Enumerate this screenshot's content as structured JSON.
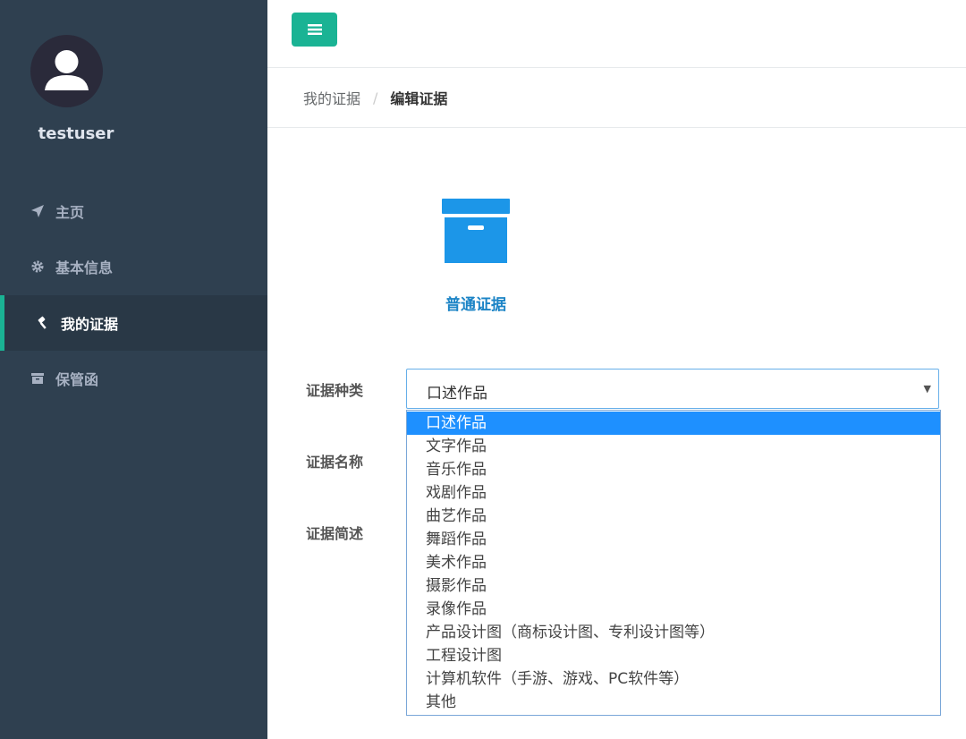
{
  "user": {
    "name": "testuser"
  },
  "nav": [
    {
      "label": "主页",
      "icon": "paper-plane-icon"
    },
    {
      "label": "基本信息",
      "icon": "gear-icon"
    },
    {
      "label": "我的证据",
      "icon": "gavel-icon",
      "active": true
    },
    {
      "label": "保管函",
      "icon": "archive-icon"
    }
  ],
  "toolbar": {
    "menu_icon": "hamburger-icon"
  },
  "breadcrumb": {
    "parent": "我的证据",
    "separator": "/",
    "current": "编辑证据"
  },
  "evidence_card": {
    "icon": "archive-box-icon",
    "label": "普通证据"
  },
  "form": {
    "type_label": "证据种类",
    "name_label": "证据名称",
    "desc_label": "证据简述",
    "type_value": "口述作品",
    "type_options": [
      "口述作品",
      "文字作品",
      "音乐作品",
      "戏剧作品",
      "曲艺作品",
      "舞蹈作品",
      "美术作品",
      "摄影作品",
      "录像作品",
      "产品设计图（商标设计图、专利设计图等）",
      "工程设计图",
      "计算机软件（手游、游戏、PC软件等）",
      "其他"
    ]
  },
  "colors": {
    "sidebar": "#2f4050",
    "accent": "#1ab394",
    "link": "#1c84c6",
    "selected_option": "#1e90ff"
  }
}
